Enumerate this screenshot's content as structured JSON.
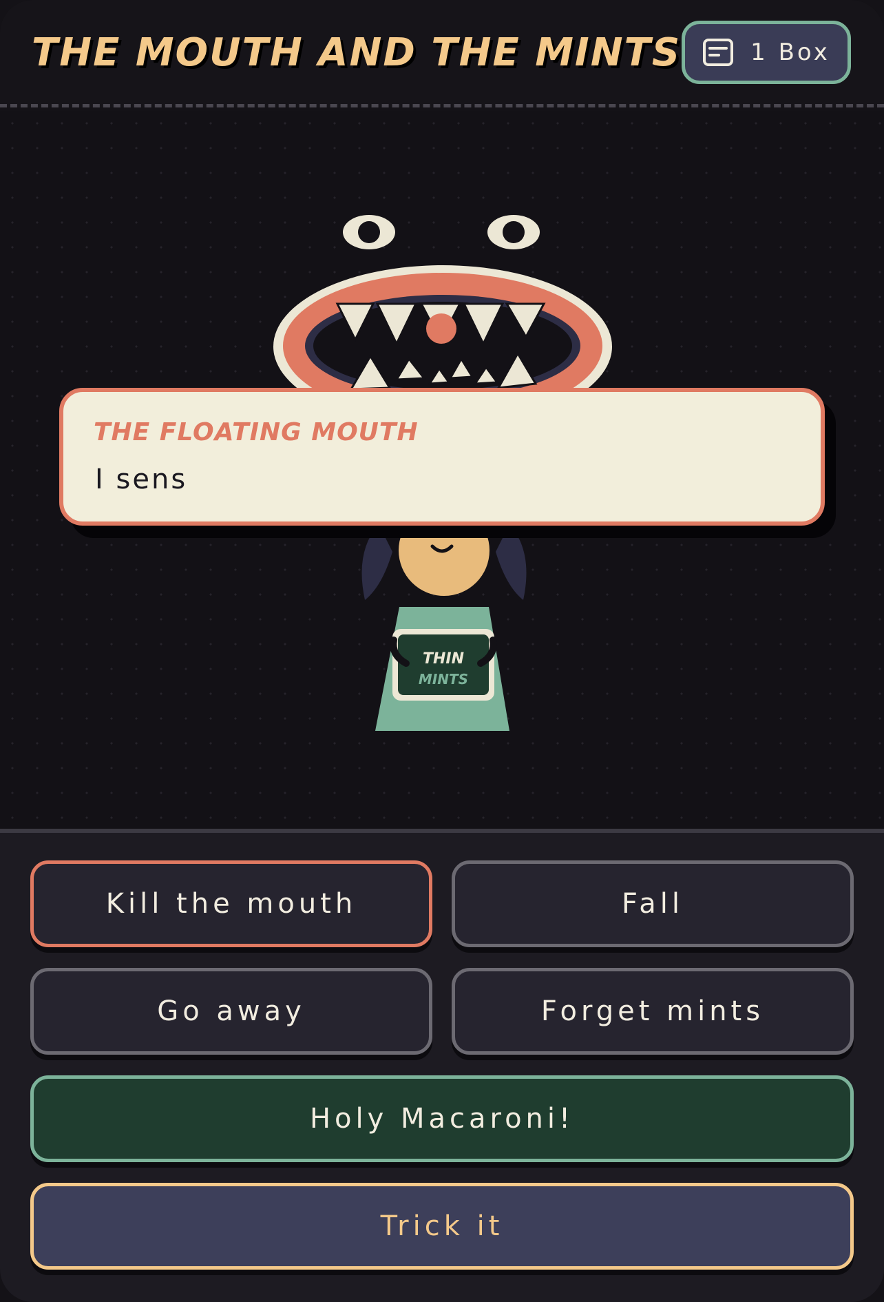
{
  "header": {
    "title": "THE MOUTH AND THE MINTS",
    "inventory_label": "1 Box",
    "inventory_icon": "note-icon"
  },
  "scene": {
    "box_label_line1": "THIN",
    "box_label_line2": "MINTS"
  },
  "dialog": {
    "speaker": "THE FLOATING MOUTH",
    "text": "I sens"
  },
  "choices": {
    "kill": "Kill the mouth",
    "fall": "Fall",
    "go_away": "Go away",
    "forget": "Forget mints",
    "holy": "Holy Macaroni!",
    "trick": "Trick it"
  },
  "colors": {
    "accent_gold": "#f4c98a",
    "accent_coral": "#e07a62",
    "accent_green": "#7cb39a",
    "background": "#141217"
  }
}
